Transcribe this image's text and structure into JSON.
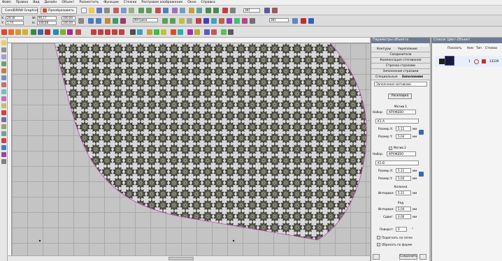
{
  "menu": [
    "Файл",
    "Правка",
    "Вид",
    "Дизайн",
    "Объект",
    "Разместить",
    "Функции",
    "Стежки",
    "Растровое изображение",
    "Окно",
    "Справка"
  ],
  "toolbar1": {
    "corel_button": "CorelDRAW Graphics",
    "convert_button": "Преобразовать",
    "zoom_value": "381"
  },
  "toolbar2": {
    "x_label": "X:",
    "x_value": "29,56",
    "y_label": "Y:",
    "y_value": "1,74",
    "w_label": "W:",
    "w_value": "90,17",
    "h_label": "H:",
    "h_value": "108,68",
    "sx_value": "100,00",
    "sy_value": "100,00",
    "units_value": "Метрика",
    "zoom_value": "381"
  },
  "object_panel": {
    "title": "Параметры объекта",
    "tab_contours": "Контуры",
    "tab_strengthen": "Укрепление",
    "tab_connectors": "Соединители",
    "tab_compensation": "Компенсация стягивания",
    "tab_line_rhinestones": "Строчка стразами",
    "tab_fill_rhinestones": "Заполнение стразами",
    "tab_special": "Специальные",
    "tab_fill": "Заполнение",
    "fill_type": "Заполнение мотивами",
    "layout_button": "Раскладка",
    "motif1_heading": "Мотив 1",
    "set_label": "Набор:",
    "set1_value": "КРУЖЕВО",
    "motif1_value": "К1-А",
    "size_x_label": "Размер X:",
    "size_y_label": "Размер Y:",
    "motif1_size_x": "5.11",
    "motif1_size_y": "5.04",
    "unit_mm": "мм",
    "motif2_checkbox": "Мотив 2",
    "set2_value": "КРУЖЕВО",
    "motif2_value": "К1-В",
    "motif2_size_x": "5.11",
    "motif2_size_y": "5.04",
    "column_heading": "Колонка",
    "interval_label": "Интервал:",
    "column_interval": "5.11",
    "row_heading": "Ряд",
    "row_interval": "5.04",
    "shift_label": "Сдвиг:",
    "row_shift": "0.00",
    "rotation_label": "Поворот:",
    "rotation_value": "0",
    "rotation_unit": "°",
    "snap_grid_label": "Подогнать по сетке",
    "trim_shape_label": "Обрезать по форме",
    "save_button": "Сохранить"
  },
  "color_panel": {
    "title": "Список Цвет-Объект",
    "col_show": "Показать",
    "col_num": "Ном",
    "col_type": "Тип",
    "col_stitches": "Стежки",
    "row_number": "1",
    "row_stitches": "13239"
  },
  "colors": {
    "accent": "#6b7b93",
    "fill_motif": "#4a4a40",
    "outline": "#c04ab8"
  }
}
